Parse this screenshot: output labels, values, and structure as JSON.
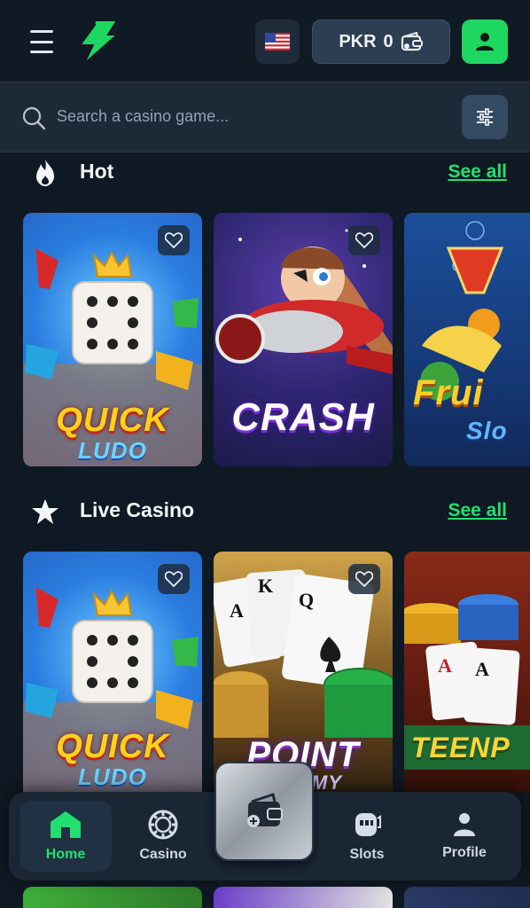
{
  "header": {
    "menu_icon": "hamburger-menu-icon",
    "logo_icon": "lightning-4-logo",
    "flag_icon": "us-flag-icon",
    "currency": "PKR",
    "balance": "0",
    "wallet_icon": "wallet-icon",
    "profile_icon": "user-icon",
    "accent": "#1ed760"
  },
  "search": {
    "placeholder": "Search a casino game...",
    "filter_icon": "sliders-icon"
  },
  "sections": [
    {
      "title": "Hot",
      "icon": "flame-icon",
      "see_all": "See all",
      "games": [
        {
          "name": "QUICK LUDO",
          "line1": "QUICK",
          "line2": "LUDO"
        },
        {
          "name": "CRASH",
          "line1": "CRASH",
          "line2": ""
        },
        {
          "name": "Fruit Slots",
          "line1": "Frui",
          "line2": "Slo"
        }
      ]
    },
    {
      "title": "Live Casino",
      "icon": "star-icon",
      "see_all": "See all",
      "games": [
        {
          "name": "QUICK LUDO",
          "line1": "QUICK",
          "line2": "LUDO"
        },
        {
          "name": "POINT RUMMY",
          "line1": "POINT",
          "line2": "RUMMY"
        },
        {
          "name": "TEEN PATTI",
          "line1": "TEENP",
          "line2": ""
        }
      ]
    }
  ],
  "bottom_nav": {
    "items": [
      {
        "label": "Home",
        "icon": "home-icon",
        "active": true
      },
      {
        "label": "Casino",
        "icon": "chip-icon",
        "active": false
      },
      {
        "label": "Slots",
        "icon": "slot-machine-icon",
        "active": false
      },
      {
        "label": "Profile",
        "icon": "user-icon",
        "active": false
      }
    ],
    "center_icon": "wallet-plus-icon"
  }
}
